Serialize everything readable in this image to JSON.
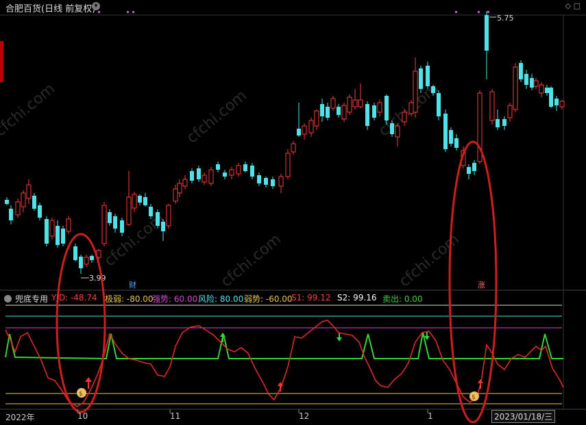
{
  "header": {
    "title": "合肥百货(日线 前复权)",
    "icons": [
      "diamond-icon",
      "box-icon"
    ]
  },
  "price_chart": {
    "high_label": "5.75",
    "low_label": "3.99",
    "finance_marker": "财",
    "rise_marker": "涨",
    "colors": {
      "up": "#ff3b3b",
      "down": "#4fe3e9"
    }
  },
  "indicator": {
    "name": "兜底专用",
    "labels": [
      {
        "text": "YJD: -48.74",
        "color": "#ff3b3b"
      },
      {
        "text": "极弱: -80.00",
        "color": "#e6c84a"
      },
      {
        "text": "强势: 60.00",
        "color": "#d64ad8"
      },
      {
        "text": "风险: 80.00",
        "color": "#4fe3e9"
      },
      {
        "text": "弱势: -60.00",
        "color": "#e6c84a"
      },
      {
        "text": "S1: 99.12",
        "color": "#ff3b3b"
      },
      {
        "text": "S2: 99.16",
        "color": "#ffffff"
      },
      {
        "text": "卖出: 0.00",
        "color": "#36d436"
      }
    ]
  },
  "x_axis": {
    "labels": [
      "2022年",
      "10",
      "11",
      "12",
      "1"
    ],
    "current_date": "2023/01/18/三"
  },
  "watermark": "cfchi.com"
}
